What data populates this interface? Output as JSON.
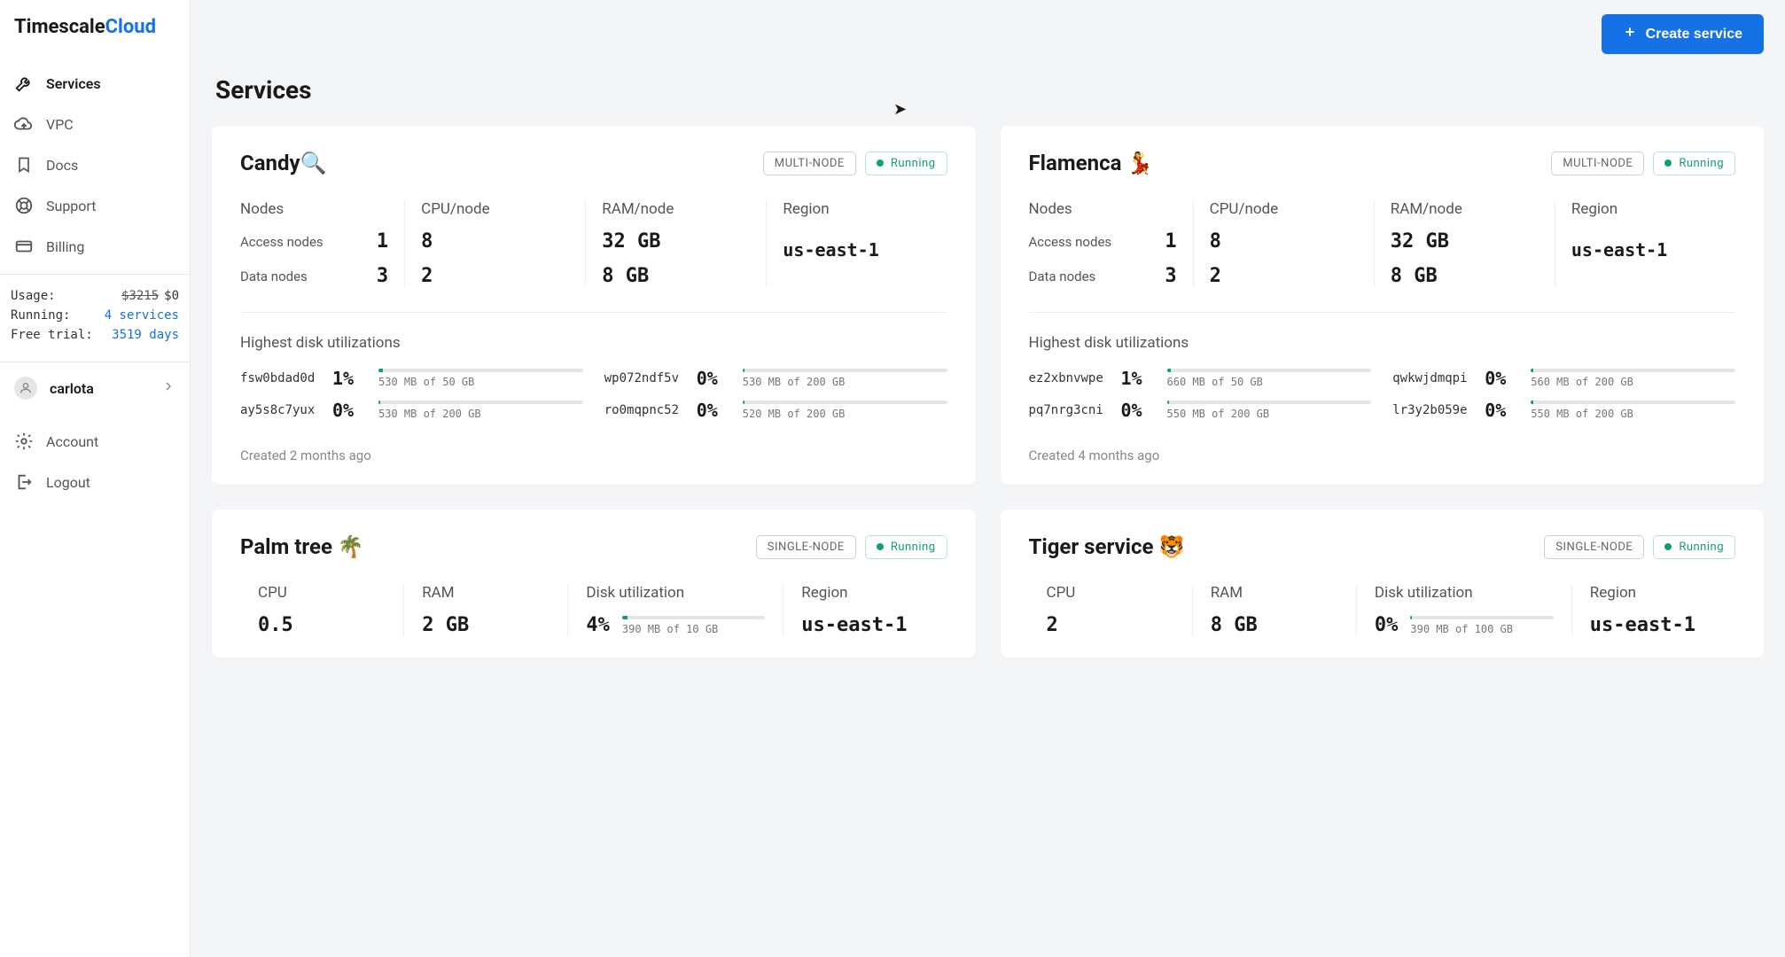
{
  "brand": {
    "a": "Timescale",
    "b": "Cloud"
  },
  "sidebar": {
    "items": [
      {
        "label": "Services"
      },
      {
        "label": "VPC"
      },
      {
        "label": "Docs"
      },
      {
        "label": "Support"
      },
      {
        "label": "Billing"
      }
    ],
    "usage": {
      "label": "Usage:",
      "strike": "$3215",
      "value": "$0",
      "running_label": "Running:",
      "running_value": "4 services",
      "trial_label": "Free trial:",
      "trial_value": "3519 days"
    },
    "profile": {
      "name": "carlota"
    },
    "lower": [
      {
        "label": "Account"
      },
      {
        "label": "Logout"
      }
    ]
  },
  "header": {
    "create": "Create service",
    "title": "Services"
  },
  "labels": {
    "nodes": "Nodes",
    "cpu_node": "CPU/node",
    "ram_node": "RAM/node",
    "region": "Region",
    "access_nodes": "Access nodes",
    "data_nodes": "Data nodes",
    "disk_title": "Highest disk utilizations",
    "cpu": "CPU",
    "ram": "RAM",
    "disk_util": "Disk utilization"
  },
  "badge_multi": "MULTI-NODE",
  "badge_single": "SINGLE-NODE",
  "status_running": "Running",
  "services": [
    {
      "name": "Candy🔍",
      "type": "multi",
      "nodes_access": "1",
      "nodes_data": "3",
      "cpu_access": "8",
      "cpu_data": "2",
      "ram_access": "32 GB",
      "ram_data": "8 GB",
      "region": "us-east-1",
      "disks": [
        {
          "id": "fsw0bdad0d",
          "pct": "1%",
          "fill": 2,
          "sub": "530 MB of 50 GB"
        },
        {
          "id": "wp072ndf5v",
          "pct": "0%",
          "fill": 1,
          "sub": "530 MB of 200 GB"
        },
        {
          "id": "ay5s8c7yux",
          "pct": "0%",
          "fill": 1,
          "sub": "530 MB of 200 GB"
        },
        {
          "id": "ro0mqpnc52",
          "pct": "0%",
          "fill": 1,
          "sub": "520 MB of 200 GB"
        }
      ],
      "created": "Created 2 months ago"
    },
    {
      "name": "Flamenca 💃",
      "type": "multi",
      "nodes_access": "1",
      "nodes_data": "3",
      "cpu_access": "8",
      "cpu_data": "2",
      "ram_access": "32 GB",
      "ram_data": "8 GB",
      "region": "us-east-1",
      "disks": [
        {
          "id": "ez2xbnvwpe",
          "pct": "1%",
          "fill": 2,
          "sub": "660 MB of 50 GB"
        },
        {
          "id": "qwkwjdmqpi",
          "pct": "0%",
          "fill": 1,
          "sub": "560 MB of 200 GB"
        },
        {
          "id": "pq7nrg3cni",
          "pct": "0%",
          "fill": 1,
          "sub": "550 MB of 200 GB"
        },
        {
          "id": "lr3y2b059e",
          "pct": "0%",
          "fill": 1,
          "sub": "550 MB of 200 GB"
        }
      ],
      "created": "Created 4 months ago"
    },
    {
      "name": "Palm tree 🌴",
      "type": "single",
      "cpu": "0.5",
      "ram": "2 GB",
      "disk_pct": "4%",
      "disk_fill": 4,
      "disk_sub": "390 MB of 10 GB",
      "region": "us-east-1"
    },
    {
      "name": "Tiger service 🐯",
      "type": "single",
      "cpu": "2",
      "ram": "8 GB",
      "disk_pct": "0%",
      "disk_fill": 1,
      "disk_sub": "390 MB of 100 GB",
      "region": "us-east-1"
    }
  ]
}
